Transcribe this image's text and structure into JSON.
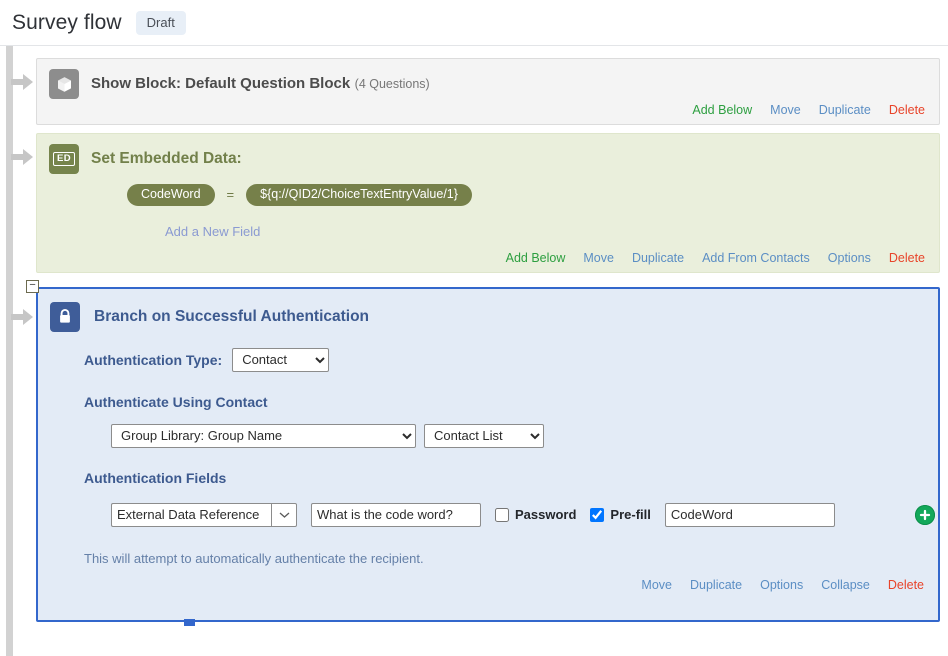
{
  "header": {
    "title": "Survey flow",
    "status_badge": "Draft"
  },
  "flow": {
    "block_element": {
      "icon": "cube-icon",
      "title": "Show Block: Default Question Block",
      "subtitle": "(4 Questions)",
      "links": [
        {
          "label": "Add Below",
          "kind": "add"
        },
        {
          "label": "Move",
          "kind": "blue"
        },
        {
          "label": "Duplicate",
          "kind": "blue"
        },
        {
          "label": "Delete",
          "kind": "delete"
        }
      ]
    },
    "embedded_data_element": {
      "icon": "ed-badge-icon",
      "icon_text": "ED",
      "title": "Set Embedded Data:",
      "field_name": "CodeWord",
      "equals": "=",
      "field_value": "${q://QID2/ChoiceTextEntryValue/1}",
      "add_field_label": "Add a New Field",
      "links": [
        {
          "label": "Add Below",
          "kind": "add"
        },
        {
          "label": "Move",
          "kind": "blue"
        },
        {
          "label": "Duplicate",
          "kind": "blue"
        },
        {
          "label": "Add From Contacts",
          "kind": "blue"
        },
        {
          "label": "Options",
          "kind": "blue"
        },
        {
          "label": "Delete",
          "kind": "delete"
        }
      ]
    },
    "branch_element": {
      "icon": "lock-icon",
      "collapse_toggle": "−",
      "title": "Branch on Successful Authentication",
      "auth_type_label": "Authentication Type:",
      "auth_type_value": "Contact",
      "auth_type_options": [
        "Contact"
      ],
      "authenticate_using_label": "Authenticate Using Contact",
      "group_library_value": "Group Library: Group Name",
      "group_library_options": [
        "Group Library: Group Name"
      ],
      "contact_list_value": "Contact List",
      "contact_list_options": [
        "Contact List"
      ],
      "auth_fields_label": "Authentication Fields",
      "field_row": {
        "field_type_value": "External Data Reference",
        "question_value": "What is the code word?",
        "question_placeholder": "",
        "password_label": "Password",
        "password_checked": false,
        "prefill_label": "Pre-fill",
        "prefill_checked": true,
        "prefill_value": "CodeWord",
        "add_button": "add-field-button"
      },
      "hint": "This will attempt to automatically authenticate the recipient.",
      "links": [
        {
          "label": "Move",
          "kind": "blue"
        },
        {
          "label": "Duplicate",
          "kind": "blue"
        },
        {
          "label": "Options",
          "kind": "blue"
        },
        {
          "label": "Collapse",
          "kind": "blue"
        },
        {
          "label": "Delete",
          "kind": "delete"
        }
      ]
    }
  },
  "colors": {
    "branch_border": "#3367cc",
    "branch_bg": "#e3ebf6",
    "ed_bg": "#eaefdc",
    "ed_pill": "#76804a",
    "block_bg": "#f4f4f4",
    "link_add": "#2d9f40",
    "link_blue": "#5b8ec4",
    "link_delete": "#e8442a",
    "add_button_green": "#12a85a"
  }
}
